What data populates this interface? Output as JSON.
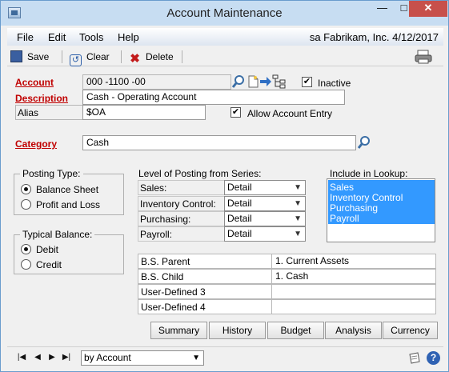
{
  "window": {
    "title": "Account Maintenance"
  },
  "menu": {
    "items": [
      "File",
      "Edit",
      "Tools",
      "Help"
    ],
    "company_info": "sa  Fabrikam, Inc.  4/12/2017"
  },
  "toolbar": {
    "save": "Save",
    "clear": "Clear",
    "delete": "Delete"
  },
  "form": {
    "account_label": "Account",
    "account_value": "000 -1100 -00",
    "inactive_label": "Inactive",
    "inactive_checked": true,
    "description_label": "Description",
    "description_value": "Cash - Operating Account",
    "alias_label": "Alias",
    "alias_value": "$OA",
    "allow_entry_label": "Allow Account Entry",
    "allow_entry_checked": true,
    "category_label": "Category",
    "category_value": "Cash"
  },
  "posting_type": {
    "title": "Posting Type:",
    "options": [
      "Balance Sheet",
      "Profit and Loss"
    ],
    "selected": "Balance Sheet"
  },
  "typical_balance": {
    "title": "Typical Balance:",
    "options": [
      "Debit",
      "Credit"
    ],
    "selected": "Debit"
  },
  "level_of_posting": {
    "title": "Level of Posting from Series:",
    "rows": [
      {
        "label": "Sales:",
        "value": "Detail"
      },
      {
        "label": "Inventory Control:",
        "value": "Detail"
      },
      {
        "label": "Purchasing:",
        "value": "Detail"
      },
      {
        "label": "Payroll:",
        "value": "Detail"
      }
    ]
  },
  "lookup": {
    "title": "Include in Lookup:",
    "items": [
      "Sales",
      "Inventory Control",
      "Purchasing",
      "Payroll"
    ]
  },
  "bs_table": [
    {
      "label": "B.S. Parent",
      "value": "1. Current Assets"
    },
    {
      "label": "B.S. Child",
      "value": "1. Cash"
    },
    {
      "label": "User-Defined 3",
      "value": ""
    },
    {
      "label": "User-Defined 4",
      "value": ""
    }
  ],
  "buttons": {
    "summary": "Summary",
    "history": "History",
    "budget": "Budget",
    "analysis": "Analysis",
    "currency": "Currency"
  },
  "bottom": {
    "sort_value": "by Account",
    "help_glyph": "?"
  },
  "colors": {
    "titlebar": "#c7ddf2",
    "required_label": "#c00000",
    "selection": "#3399ff",
    "close_button": "#c7504b"
  }
}
